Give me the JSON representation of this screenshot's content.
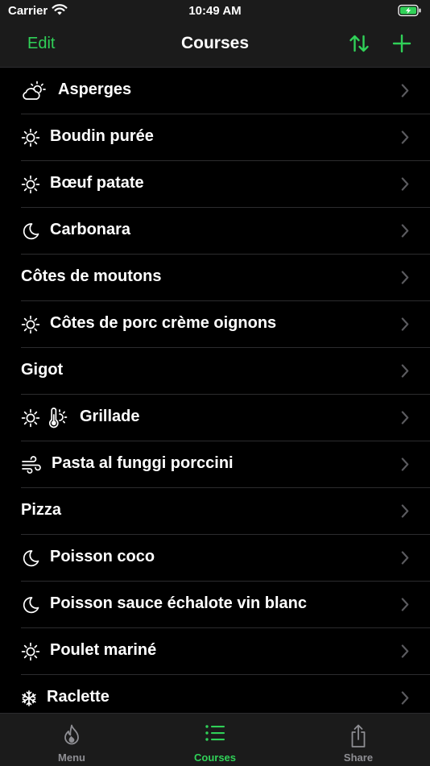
{
  "status_bar": {
    "carrier": "Carrier",
    "time": "10:49 AM"
  },
  "nav": {
    "edit_label": "Edit",
    "title": "Courses"
  },
  "courses": [
    {
      "name": "Asperges",
      "icons": [
        "cloud-sun-icon"
      ]
    },
    {
      "name": "Boudin purée",
      "icons": [
        "sun-icon"
      ]
    },
    {
      "name": "Bœuf patate",
      "icons": [
        "sun-icon"
      ]
    },
    {
      "name": "Carbonara",
      "icons": [
        "moon-icon"
      ]
    },
    {
      "name": "Côtes de moutons",
      "icons": []
    },
    {
      "name": "Côtes de porc crème oignons",
      "icons": [
        "sun-icon"
      ]
    },
    {
      "name": "Gigot",
      "icons": []
    },
    {
      "name": "Grillade",
      "icons": [
        "sun-icon",
        "thermometer-sun-icon"
      ]
    },
    {
      "name": "Pasta al funggi porccini",
      "icons": [
        "wind-icon"
      ]
    },
    {
      "name": "Pizza",
      "icons": []
    },
    {
      "name": "Poisson coco",
      "icons": [
        "moon-icon"
      ]
    },
    {
      "name": "Poisson sauce échalote vin blanc",
      "icons": [
        "moon-icon"
      ]
    },
    {
      "name": "Poulet mariné",
      "icons": [
        "sun-icon"
      ]
    },
    {
      "name": "Raclette",
      "icons": [
        "snowflake-icon"
      ]
    }
  ],
  "tabs": [
    {
      "label": "Menu",
      "icon": "flame-icon",
      "active": false
    },
    {
      "label": "Courses",
      "icon": "list-icon",
      "active": true
    },
    {
      "label": "Share",
      "icon": "share-icon",
      "active": false
    }
  ],
  "colors": {
    "accent": "#30d158",
    "background": "#000000",
    "bar": "#1b1b1b",
    "separator": "#2c2c2e",
    "inactive": "#8e8e93"
  }
}
